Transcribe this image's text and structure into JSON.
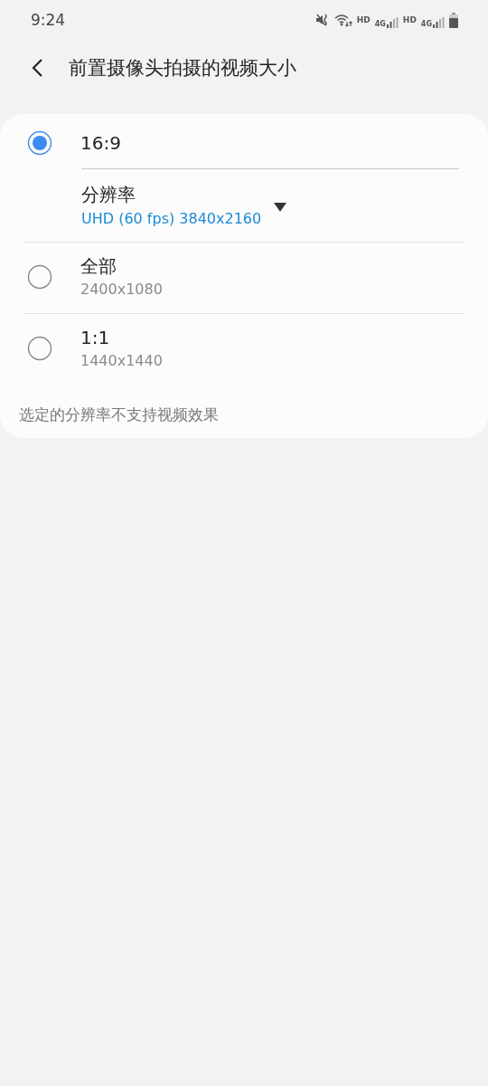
{
  "status_bar": {
    "time": "9:24",
    "sim_1": {
      "hd": "HD",
      "network": "4G"
    },
    "sim_2": {
      "hd": "HD",
      "network": "4G"
    }
  },
  "header": {
    "title": "前置摄像头拍摄的视频大小"
  },
  "options": [
    {
      "label": "16:9",
      "selected": true,
      "resolution": {
        "label": "分辨率",
        "value": "UHD (60 fps) 3840x2160"
      }
    },
    {
      "label": "全部",
      "selected": false,
      "detail": "2400x1080"
    },
    {
      "label": "1:1",
      "selected": false,
      "detail": "1440x1440"
    }
  ],
  "note": "选定的分辨率不支持视频效果"
}
